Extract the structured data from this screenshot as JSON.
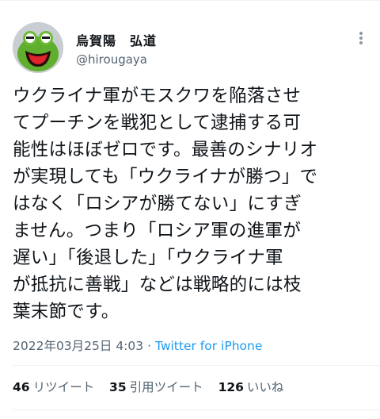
{
  "user": {
    "display_name": "烏賀陽　弘道",
    "handle": "@hirougaya",
    "avatar_icon": "kermit-avatar-icon"
  },
  "tweet": {
    "lines": [
      "ウクライナ軍がモスクワを陥落させ",
      "てプーチンを戦犯として逮捕する可",
      "能性はほぼゼロです。最善のシナリオ",
      "が実現しても「ウクライナが勝つ」で",
      "はなく「ロシアが勝てない」にすぎ",
      "ません。つまり「ロシア軍の進軍が",
      "遅い」「後退した」「ウクライナ軍",
      "が抵抗に善戦」などは戦略的には枝",
      "葉末節です。"
    ],
    "timestamp": "2022年03月25日 4:03",
    "separator": " · ",
    "source": "Twitter for iPhone"
  },
  "stats": {
    "retweets": {
      "count": "46",
      "label": "リツイート"
    },
    "quotes": {
      "count": "35",
      "label": "引用ツイート"
    },
    "likes": {
      "count": "126",
      "label": "いいね"
    }
  },
  "colors": {
    "accent": "#1d9bf0",
    "text": "#0f1419",
    "secondary": "#536471",
    "divider": "#eff3f4"
  }
}
